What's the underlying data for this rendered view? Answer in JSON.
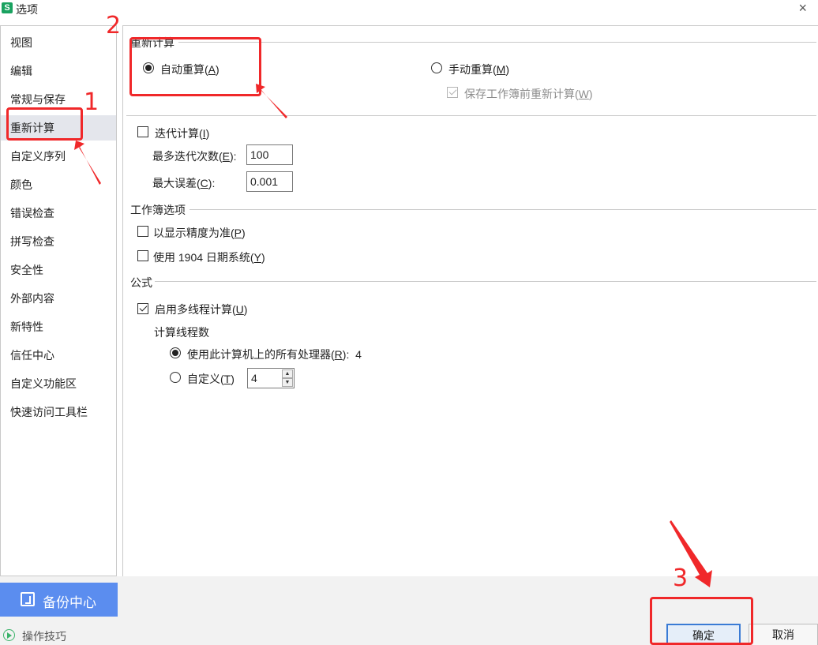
{
  "window": {
    "title": "选项",
    "app_icon": "S",
    "close_glyph": "×"
  },
  "sidebar": {
    "items": [
      {
        "label": "视图"
      },
      {
        "label": "编辑"
      },
      {
        "label": "常规与保存"
      },
      {
        "label": "重新计算",
        "active": true
      },
      {
        "label": "自定义序列"
      },
      {
        "label": "颜色"
      },
      {
        "label": "错误检查"
      },
      {
        "label": "拼写检查"
      },
      {
        "label": "安全性"
      },
      {
        "label": "外部内容"
      },
      {
        "label": "新特性"
      },
      {
        "label": "信任中心"
      },
      {
        "label": "自定义功能区"
      },
      {
        "label": "快速访问工具栏"
      }
    ],
    "backup_label": "备份中心",
    "tips_label": "操作技巧"
  },
  "recalc": {
    "section_title": "重新计算",
    "auto": {
      "text": "自动重算(",
      "key": "A",
      "end": ")",
      "checked": true
    },
    "manual": {
      "text": "手动重算(",
      "key": "M",
      "end": ")",
      "checked": false
    },
    "save_before": {
      "text": "保存工作簿前重新计算(",
      "key": "W",
      "end": ")",
      "checked": true,
      "disabled": true
    },
    "iterative": {
      "text": "迭代计算(",
      "key": "I",
      "end": ")",
      "checked": false
    },
    "max_iter": {
      "text": "最多迭代次数(",
      "key": "E",
      "end": "):",
      "value": "100"
    },
    "max_change": {
      "text": "最大误差(",
      "key": "C",
      "end": "):",
      "value": "0.001"
    }
  },
  "workbook": {
    "section_title": "工作簿选项",
    "precision": {
      "text": "以显示精度为准(",
      "key": "P",
      "end": ")",
      "checked": false
    },
    "date1904": {
      "text": "使用 1904 日期系统(",
      "key": "Y",
      "end": ")",
      "checked": false
    }
  },
  "formula": {
    "section_title": "公式",
    "multithread": {
      "text": "启用多线程计算(",
      "key": "U",
      "end": ")",
      "checked": true
    },
    "threads_title": "计算线程数",
    "all_processors": {
      "text": "使用此计算机上的所有处理器(",
      "key": "R",
      "end": "):",
      "count": "4",
      "checked": true
    },
    "custom": {
      "text": "自定义(",
      "key": "T",
      "end": ")",
      "value": "4",
      "checked": false
    }
  },
  "buttons": {
    "ok": "确定",
    "cancel": "取消"
  },
  "annotations": {
    "numbers": [
      "1",
      "2",
      "3"
    ],
    "color": "#f0282a"
  },
  "colors": {
    "accent": "#5b8def",
    "active_nav": "#e4e6ec",
    "ok_border": "#3a7bd5"
  }
}
